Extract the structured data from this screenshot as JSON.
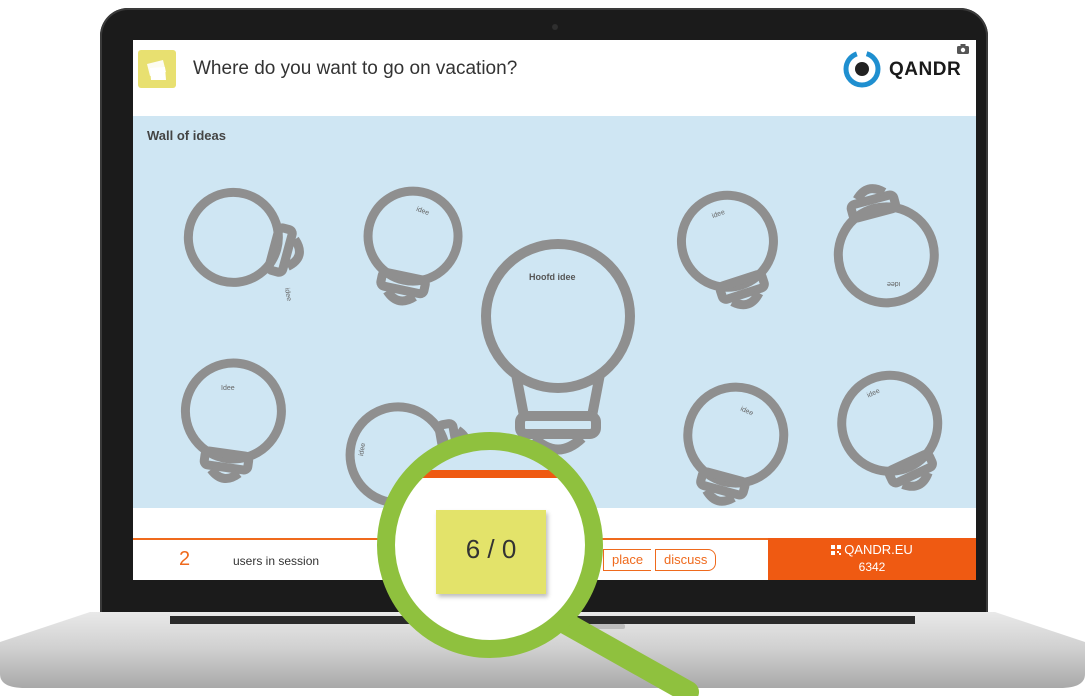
{
  "header": {
    "question": "Where do you want to go on vacation?",
    "brand": "QANDR"
  },
  "wall": {
    "title": "Wall of ideas",
    "main_idea": "Hoofd idee",
    "idea_label": "Idee",
    "idea_label_small": "idee"
  },
  "footer": {
    "user_count": "2",
    "users_label": "users in session",
    "place_button": "place",
    "discuss_button": "discuss",
    "site": "QANDR.EU",
    "session_code": "6342"
  },
  "counter": {
    "value": "6 / 0"
  },
  "colors": {
    "accent": "#ef6a1d",
    "wall_bg": "#cfe6f3",
    "bulb": "#8f8f8f",
    "highlight": "#e3e36a",
    "magnifier": "#8fc13e"
  }
}
